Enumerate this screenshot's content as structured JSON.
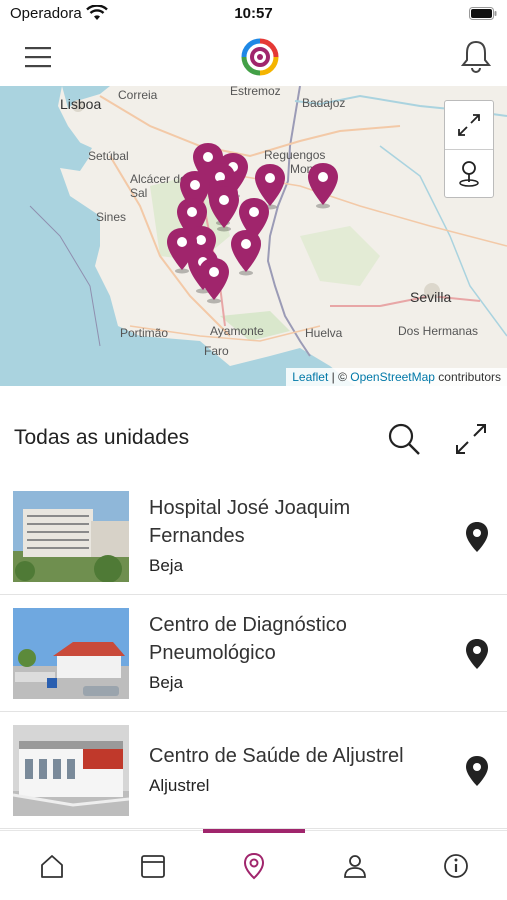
{
  "status_bar": {
    "carrier": "Operadora",
    "time": "10:57"
  },
  "header": {
    "menu_icon": "hamburger-menu-icon",
    "logo_icon": "app-logo-icon",
    "notification_icon": "bell-icon"
  },
  "map": {
    "labels": [
      "Lisboa",
      "Correia",
      "Estremoz",
      "Badajoz",
      "Setúbal",
      "Alcácer do Sal",
      "Reguengos",
      "Mon",
      "Sines",
      "Sevilla",
      "Portimão",
      "Ayamonte",
      "Huelva",
      "Dos Hermanas",
      "Faro"
    ],
    "marker_count": 15,
    "marker_color": "#a0256c",
    "controls": {
      "fullscreen_icon": "expand-arrows-icon",
      "locate_icon": "pin-locate-icon"
    },
    "attribution": {
      "leaflet": "Leaflet",
      "separator": " | © ",
      "osm": "OpenStreetMap",
      "suffix": " contributors"
    }
  },
  "units_section": {
    "title": "Todas as unidades",
    "search_icon": "search-icon",
    "expand_icon": "expand-arrows-icon",
    "items": [
      {
        "name": "Hospital José Joaquim Fernandes",
        "city": "Beja"
      },
      {
        "name": "Centro de Diagnóstico Pneumológico",
        "city": "Beja"
      },
      {
        "name": "Centro de Saúde de Aljustrel",
        "city": "Aljustrel"
      }
    ]
  },
  "tab_bar": {
    "active_index": 2,
    "accent": "#a0256c",
    "tabs": [
      {
        "icon": "home-icon"
      },
      {
        "icon": "calendar-icon"
      },
      {
        "icon": "map-pin-icon"
      },
      {
        "icon": "user-icon"
      },
      {
        "icon": "info-icon"
      }
    ]
  }
}
